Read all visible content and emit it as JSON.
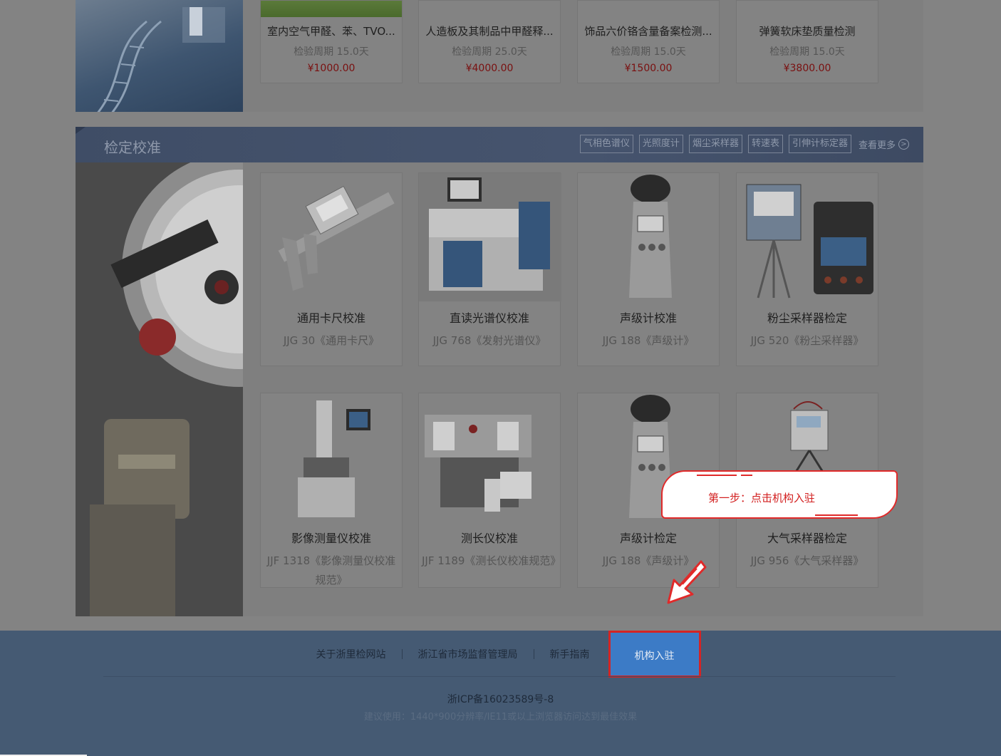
{
  "colors": {
    "accent_red": "#e02a2a",
    "footer_bg": "#455a73",
    "active_link": "#3c7bc6"
  },
  "top_products": [
    {
      "name": "室内空气甲醛、苯、TVO...",
      "period": "检验周期 15.0天",
      "price": "¥1000.00"
    },
    {
      "name": "人造板及其制品中甲醛释...",
      "period": "检验周期 25.0天",
      "price": "¥4000.00"
    },
    {
      "name": "饰品六价铬含量备案检测...",
      "period": "检验周期 15.0天",
      "price": "¥1500.00"
    },
    {
      "name": "弹簧软床垫质量检测",
      "period": "检验周期 15.0天",
      "price": "¥3800.00"
    }
  ],
  "calibration": {
    "title": "检定校准",
    "tags": [
      "气相色谱仪",
      "光照度计",
      "烟尘采样器",
      "转速表",
      "引伸计标定器"
    ],
    "more": "查看更多",
    "more_icon": "circle-arrow-right-icon",
    "items": [
      {
        "title": "通用卡尺校准",
        "std": "JJG 30《通用卡尺》",
        "icon": "caliper"
      },
      {
        "title": "直读光谱仪校准",
        "std": "JJG 768《发射光谱仪》",
        "icon": "spectrometer"
      },
      {
        "title": "声级计校准",
        "std": "JJG 188《声级计》",
        "icon": "sound-meter"
      },
      {
        "title": "粉尘采样器检定",
        "std": "JJG 520《粉尘采样器》",
        "icon": "dust-sampler"
      },
      {
        "title": "影像测量仪校准",
        "std": "JJF 1318《影像测量仪校准规范》",
        "icon": "image-measurer"
      },
      {
        "title": "测长仪校准",
        "std": "JJF 1189《测长仪校准规范》",
        "icon": "length-meter"
      },
      {
        "title": "声级计检定",
        "std": "JJG 188《声级计》",
        "icon": "sound-meter"
      },
      {
        "title": "大气采样器检定",
        "std": "JJG 956《大气采样器》",
        "icon": "air-sampler"
      }
    ]
  },
  "footer": {
    "links": [
      "关于浙里检网站",
      "浙江省市场监督管理局",
      "新手指南",
      "机构入驻"
    ],
    "icp": "浙ICP备16023589号-8",
    "advice": "建议使用：1440*900分辨率/IE11或以上浏览器访问达到最佳效果"
  },
  "callout": {
    "text": "第一步：点击机构入驻"
  }
}
